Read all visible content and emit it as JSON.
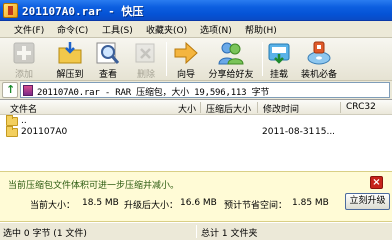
{
  "window": {
    "title": "201107A0.rar - 快压"
  },
  "menu": [
    {
      "label": "文件(F)"
    },
    {
      "label": "命令(C)"
    },
    {
      "label": "工具(S)"
    },
    {
      "label": "收藏夹(O)"
    },
    {
      "label": "选项(N)"
    },
    {
      "label": "帮助(H)"
    }
  ],
  "toolbar": [
    {
      "label": "添加",
      "icon": "add-icon",
      "enabled": false
    },
    {
      "label": "解压到",
      "icon": "extract-folder-icon",
      "enabled": true
    },
    {
      "label": "查看",
      "icon": "magnifier-icon",
      "enabled": true
    },
    {
      "label": "删除",
      "icon": "delete-icon",
      "enabled": false
    },
    {
      "label": "向导",
      "icon": "arrow-right-icon",
      "enabled": true
    },
    {
      "label": "分享给好友",
      "icon": "people-icon",
      "enabled": true
    },
    {
      "label": "挂载",
      "icon": "mount-drive-icon",
      "enabled": true
    },
    {
      "label": "装机必备",
      "icon": "setup-disk-icon",
      "enabled": true
    }
  ],
  "address": {
    "text": "201107A0.rar - RAR 压缩包，大小 19,596,113 字节"
  },
  "columns": {
    "name": "文件名",
    "size": "大小",
    "packed": "压缩后大小",
    "modified": "修改时间",
    "crc": "CRC32"
  },
  "rows": [
    {
      "name": "..",
      "size": "",
      "packed": "",
      "modified": "",
      "crc": ""
    },
    {
      "name": "201107A0",
      "size": "",
      "packed": "",
      "modified": "2011-08-31",
      "crc": "15..."
    }
  ],
  "info": {
    "message": "当前压缩包文件体积可进一步压缩并减小。",
    "current_size_label": "当前大小：",
    "current_size_value": "18.5 MB",
    "upgraded_size_label": "升级后大小：",
    "upgraded_size_value": "16.6 MB",
    "saving_label": "预计节省空间：",
    "saving_value": "1.85 MB",
    "upgrade_button": "立刻升级"
  },
  "status": {
    "selected": "选中  0 字节 (1 文件)",
    "total": "总计 1 文件夹"
  },
  "colors": {
    "titlebar": "#0553d6",
    "info_bg": "#fffbd6",
    "info_text": "#2c5b10",
    "close_red": "#c6231b"
  }
}
